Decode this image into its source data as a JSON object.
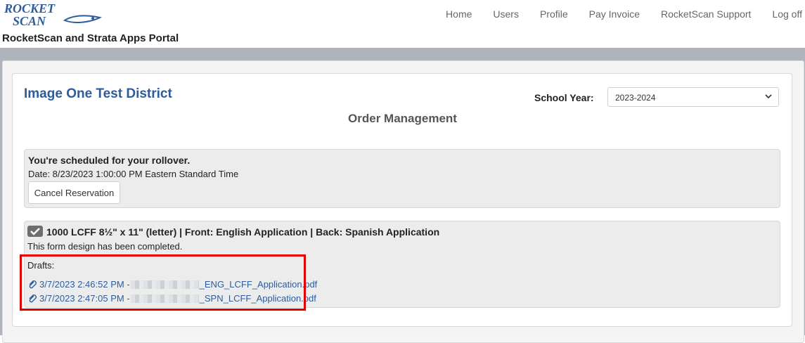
{
  "header": {
    "logo_text_line1": "ROCKET",
    "logo_text_line2": "SCAN",
    "portal_title": "RocketScan and Strata Apps Portal",
    "nav": [
      "Home",
      "Users",
      "Profile",
      "Pay Invoice",
      "RocketScan Support",
      "Log off"
    ]
  },
  "page": {
    "district": "Image One Test District",
    "school_year_label": "School Year:",
    "school_year_value": "2023-2024",
    "order_title": "Order Management"
  },
  "rollover": {
    "title": "You're scheduled for your rollover.",
    "date": "Date: 8/23/2023 1:00:00 PM Eastern Standard Time",
    "cancel_label": "Cancel Reservation"
  },
  "form": {
    "title": "1000 LCFF 8½\" x 11\" (letter) | Front: English Application | Back: Spanish Application",
    "status": "This form design has been completed.",
    "drafts_label": "Drafts:",
    "drafts": [
      {
        "prefix": "3/7/2023 2:46:52 PM - ",
        "suffix": "_ENG_LCFF_Application.pdf"
      },
      {
        "prefix": "3/7/2023 2:47:05 PM - ",
        "suffix": "_SPN_LCFF_Application.pdf"
      }
    ]
  },
  "colors": {
    "brand_blue": "#2d5c9c",
    "highlight_red": "#e00000",
    "band_gray": "#aeb3bc"
  }
}
